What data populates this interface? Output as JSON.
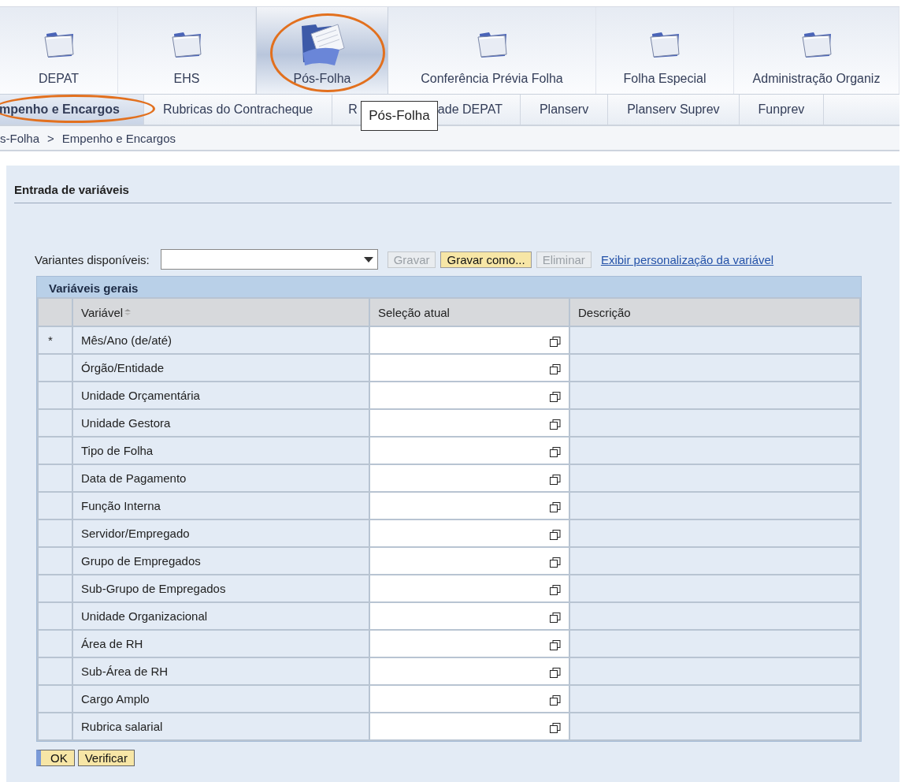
{
  "top_tabs": [
    {
      "label": "DEPAT",
      "selected": false,
      "circled": false,
      "kind": "folder"
    },
    {
      "label": "EHS",
      "selected": false,
      "circled": false,
      "kind": "folder"
    },
    {
      "label": "Pós-Folha",
      "selected": true,
      "circled": true,
      "kind": "documents"
    },
    {
      "label": "Conferência Prévia Folha",
      "selected": false,
      "circled": false,
      "kind": "folder"
    },
    {
      "label": "Folha Especial",
      "selected": false,
      "circled": false,
      "kind": "folder"
    },
    {
      "label": "Administração Organiz",
      "selected": false,
      "circled": false,
      "kind": "folder"
    }
  ],
  "sub_tabs": [
    {
      "label": "mpenho e Encargos",
      "selected": true,
      "circled": true
    },
    {
      "label": "Rubricas do Contracheque",
      "selected": false,
      "circled": false
    },
    {
      "label": "R",
      "label_after_tooltip": "ade DEPAT",
      "selected": false,
      "circled": false
    },
    {
      "label": "Planserv",
      "selected": false,
      "circled": false
    },
    {
      "label": "Planserv Suprev",
      "selected": false,
      "circled": false
    },
    {
      "label": "Funprev",
      "selected": false,
      "circled": false
    }
  ],
  "tooltip": "Pós-Folha",
  "breadcrumb": {
    "items": [
      "s-Folha",
      "Empenho e Encargos"
    ],
    "separator": ">"
  },
  "section_title": "Entrada de variáveis",
  "variants": {
    "label": "Variantes disponíveis:",
    "buttons": [
      {
        "label": "Gravar",
        "disabled": true
      },
      {
        "label": "Gravar como...",
        "disabled": false
      },
      {
        "label": "Eliminar",
        "disabled": true
      }
    ],
    "link": "Exibir personalização da variável"
  },
  "table": {
    "title": "Variáveis gerais",
    "columns": [
      "Variável",
      "Seleção atual",
      "Descrição"
    ],
    "rows": [
      {
        "marker": "*",
        "variable": "Mês/Ano (de/até)"
      },
      {
        "variable": "Órgão/Entidade"
      },
      {
        "variable": "Unidade Orçamentária"
      },
      {
        "variable": "Unidade Gestora"
      },
      {
        "variable": "Tipo de Folha"
      },
      {
        "variable": "Data de Pagamento"
      },
      {
        "variable": "Função Interna"
      },
      {
        "variable": "Servidor/Empregado"
      },
      {
        "variable": "Grupo de Empregados"
      },
      {
        "variable": "Sub-Grupo de Empregados"
      },
      {
        "variable": "Unidade Organizacional"
      },
      {
        "variable": "Área de RH"
      },
      {
        "variable": "Sub-Área de RH"
      },
      {
        "variable": "Cargo Amplo"
      },
      {
        "variable": "Rubrica salarial"
      }
    ]
  },
  "footer_buttons": [
    {
      "label": "OK",
      "focused": true
    },
    {
      "label": "Verificar",
      "focused": false
    }
  ]
}
